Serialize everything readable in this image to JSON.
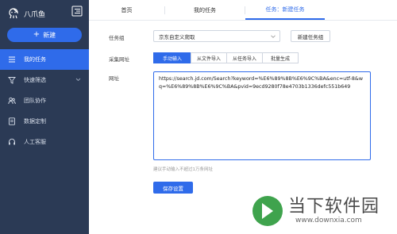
{
  "app": {
    "name": "八爪鱼"
  },
  "sidebar": {
    "new_label": "新建",
    "items": [
      {
        "label": "我的任务",
        "icon": "list-icon",
        "active": true
      },
      {
        "label": "快速筛选",
        "icon": "filter-icon",
        "has_chevron": true
      },
      {
        "label": "团队协作",
        "icon": "team-icon"
      },
      {
        "label": "数据定制",
        "icon": "document-icon"
      },
      {
        "label": "人工客服",
        "icon": "headset-icon"
      }
    ]
  },
  "tabs": [
    {
      "label": "首页"
    },
    {
      "label": "我的任务"
    },
    {
      "label": "任务：新建任务",
      "active": true
    }
  ],
  "form": {
    "group_label": "任务组",
    "group_value": "京东自定义爬取",
    "new_group_button": "新建任务组",
    "collect_label": "采集网址",
    "collect_modes": [
      "手动输入",
      "从文件导入",
      "从任务导入",
      "批量生成"
    ],
    "active_mode": "手动输入",
    "url_label": "网址",
    "url_value": "https://search.jd.com/Search?keyword=%E6%89%8B%E6%9C%BA&enc=utf-8&wq=%E6%89%8B%E6%9C%BA&pvid=9ecd9280f78e4703b1336defc551b649",
    "hint": "建议手动输入不超过1万条网址",
    "save_button": "保存设置"
  },
  "watermark": {
    "line1": "当下软件园",
    "line2": "www.downxia.com"
  },
  "colors": {
    "sidebar_bg": "#2b3a55",
    "accent": "#2f6bea"
  }
}
